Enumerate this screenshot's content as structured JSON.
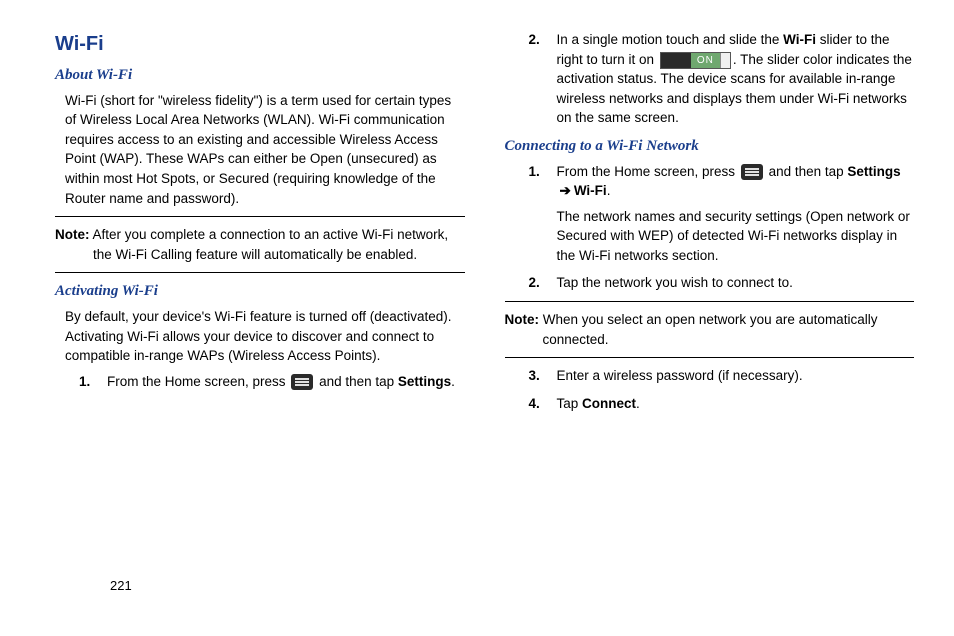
{
  "page_number": "221",
  "title": "Wi-Fi",
  "sections": {
    "about": {
      "heading": "About Wi-Fi",
      "body": "Wi-Fi (short for \"wireless fidelity\") is a term used for certain types of Wireless Local Area Networks (WLAN). Wi-Fi communication requires access to an existing and accessible Wireless Access Point (WAP). These WAPs can either be Open (unsecured) as within most Hot Spots, or Secured (requiring knowledge of the Router name and password).",
      "note_label": "Note:",
      "note_body": "After you complete a connection to an active Wi-Fi network, the Wi-Fi Calling feature will automatically be enabled."
    },
    "activating": {
      "heading": "Activating Wi-Fi",
      "body": "By default, your device's Wi-Fi feature is turned off (deactivated). Activating Wi-Fi allows your device to discover and connect to compatible in-range WAPs (Wireless Access Points).",
      "steps": {
        "s1_num": "1.",
        "s1_pre": "From the Home screen, press ",
        "s1_post": " and then tap ",
        "s1_settings": "Settings",
        "s1_period": ".",
        "s2_num": "2.",
        "s2_pre": "In a single motion touch and slide the ",
        "s2_wifi": "Wi-Fi",
        "s2_mid": " slider to the right to turn it on ",
        "s2_post": ". The slider color indicates the activation status. The device scans for available in-range wireless networks and displays them under Wi-Fi networks on the same screen.",
        "switch_on": "ON"
      }
    },
    "connecting": {
      "heading": "Connecting to a Wi-Fi Network",
      "steps": {
        "s1_num": "1.",
        "s1_pre": "From the Home screen, press ",
        "s1_post": " and then tap ",
        "s1_settings": "Settings",
        "s1_arrow": "➔",
        "s1_wifi": "Wi-Fi",
        "s1_period": ".",
        "s1_para2": "The network names and security settings (Open network or Secured with WEP) of detected Wi-Fi networks display in the Wi-Fi networks section.",
        "s2_num": "2.",
        "s2_body": "Tap the network you wish to connect to.",
        "s3_num": "3.",
        "s3_body": "Enter a wireless password (if necessary).",
        "s4_num": "4.",
        "s4_pre": "Tap ",
        "s4_connect": "Connect",
        "s4_period": "."
      },
      "note_label": "Note:",
      "note_body": "When you select an open network you are automatically connected."
    }
  }
}
